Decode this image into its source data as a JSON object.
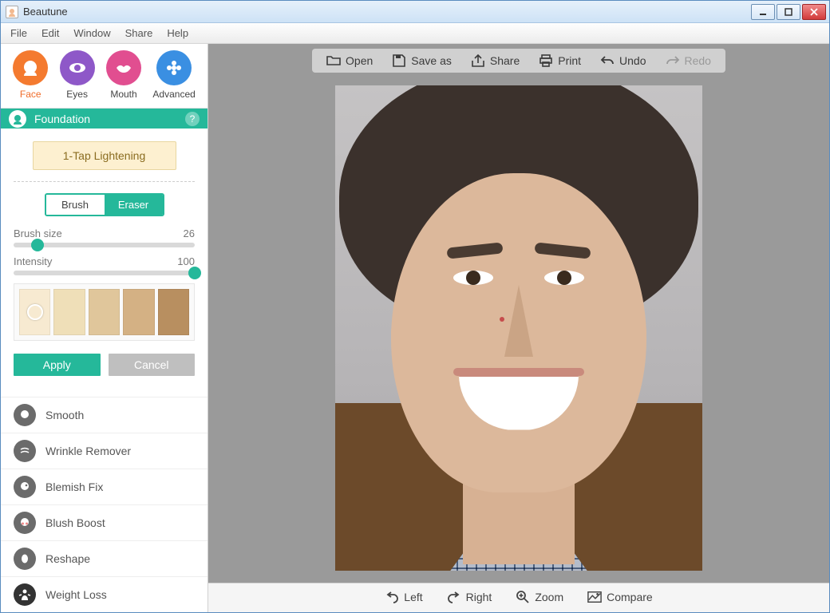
{
  "app": {
    "title": "Beautune"
  },
  "menubar": [
    "File",
    "Edit",
    "Window",
    "Share",
    "Help"
  ],
  "tabs": [
    {
      "label": "Face",
      "color": "#f47a2f",
      "icon": "face"
    },
    {
      "label": "Eyes",
      "color": "#8e58c8",
      "icon": "eye"
    },
    {
      "label": "Mouth",
      "color": "#e14e90",
      "icon": "lips"
    },
    {
      "label": "Advanced",
      "color": "#3a8fe2",
      "icon": "flower"
    }
  ],
  "active_tab": 0,
  "section": {
    "title": "Foundation",
    "one_tap_label": "1-Tap Lightening",
    "brush_eraser": {
      "brush": "Brush",
      "eraser": "Eraser",
      "active": "brush"
    },
    "brush_size": {
      "label": "Brush size",
      "value": 26,
      "min": 1,
      "max": 200
    },
    "intensity": {
      "label": "Intensity",
      "value": 100,
      "min": 0,
      "max": 100
    },
    "swatches": [
      "#f7ead1",
      "#efdfb8",
      "#e0c69b",
      "#d4b184",
      "#b88f60"
    ],
    "selected_swatch": 0,
    "apply": "Apply",
    "cancel": "Cancel"
  },
  "tools": [
    {
      "label": "Smooth",
      "icon": "smooth"
    },
    {
      "label": "Wrinkle Remover",
      "icon": "wrinkle"
    },
    {
      "label": "Blemish Fix",
      "icon": "blemish"
    },
    {
      "label": "Blush Boost",
      "icon": "blush"
    },
    {
      "label": "Reshape",
      "icon": "reshape"
    },
    {
      "label": "Weight Loss",
      "icon": "weight"
    }
  ],
  "top_toolbar": {
    "open": "Open",
    "save_as": "Save as",
    "share": "Share",
    "print": "Print",
    "undo": "Undo",
    "redo": "Redo"
  },
  "bottom_toolbar": {
    "left": "Left",
    "right": "Right",
    "zoom": "Zoom",
    "compare": "Compare"
  }
}
